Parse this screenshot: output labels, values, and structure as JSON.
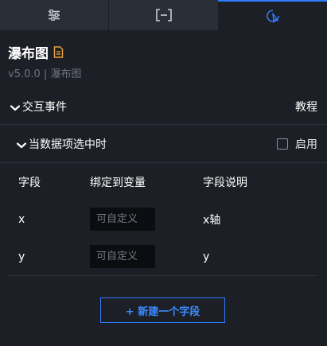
{
  "tabs": [
    {
      "icon": "sliders-icon",
      "active": false
    },
    {
      "icon": "bracket-frame-icon",
      "active": false
    },
    {
      "icon": "interaction-icon",
      "active": true
    }
  ],
  "header": {
    "title": "瀑布图",
    "version": "v5.0.0 | 瀑布图"
  },
  "interaction": {
    "label": "交互事件",
    "tutorial": "教程"
  },
  "event": {
    "label": "当数据项选中时",
    "enable_label": "启用",
    "enabled": false
  },
  "table": {
    "headers": [
      "字段",
      "绑定到变量",
      "字段说明"
    ],
    "rows": [
      {
        "field": "x",
        "placeholder": "可自定义",
        "desc": "x轴"
      },
      {
        "field": "y",
        "placeholder": "可自定义",
        "desc": "y"
      }
    ]
  },
  "add_button": {
    "label": "+ 新建一个字段"
  },
  "colors": {
    "accent": "#2f7bff",
    "background": "#1c1f25",
    "doc_icon": "#e6a23c"
  }
}
